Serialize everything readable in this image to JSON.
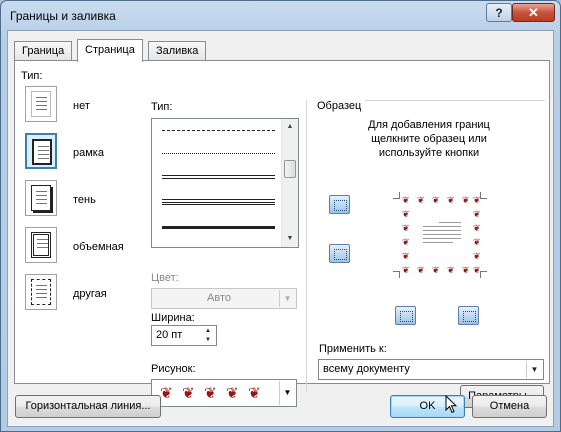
{
  "window": {
    "title": "Границы и заливка",
    "help_label": "?",
    "close_label": "✕"
  },
  "tabs": [
    {
      "label": "Граница",
      "active": false
    },
    {
      "label": "Страница",
      "active": true
    },
    {
      "label": "Заливка",
      "active": false
    }
  ],
  "settings": {
    "header": "Тип:",
    "items": [
      {
        "label": "нет",
        "icon": "page-none-icon",
        "selected": false
      },
      {
        "label": "рамка",
        "icon": "page-box-icon",
        "selected": true
      },
      {
        "label": "тень",
        "icon": "page-shadow-icon",
        "selected": false
      },
      {
        "label": "объемная",
        "icon": "page-3d-icon",
        "selected": false
      },
      {
        "label": "другая",
        "icon": "page-custom-icon",
        "selected": false
      }
    ]
  },
  "style": {
    "header": "Тип:",
    "color_label": "Цвет:",
    "color_value": "Авто",
    "width_label": "Ширина:",
    "width_value": "20 пт",
    "art_label": "Рисунок:",
    "art_glyph": "❦"
  },
  "preview": {
    "header": "Образец",
    "instructions": [
      "Для добавления границ",
      "щелкните образец или",
      "используйте кнопки"
    ],
    "apply_label": "Применить к:",
    "apply_value": "всему документу",
    "options_label": "Параметры...",
    "border_glyph": "❦"
  },
  "footer": {
    "horizontal_line_label": "Горизонтальная линия...",
    "ok_label": "OK",
    "cancel_label": "Отмена"
  },
  "colors": {
    "accent": "#3c7fb1",
    "art": "#9b1616"
  }
}
